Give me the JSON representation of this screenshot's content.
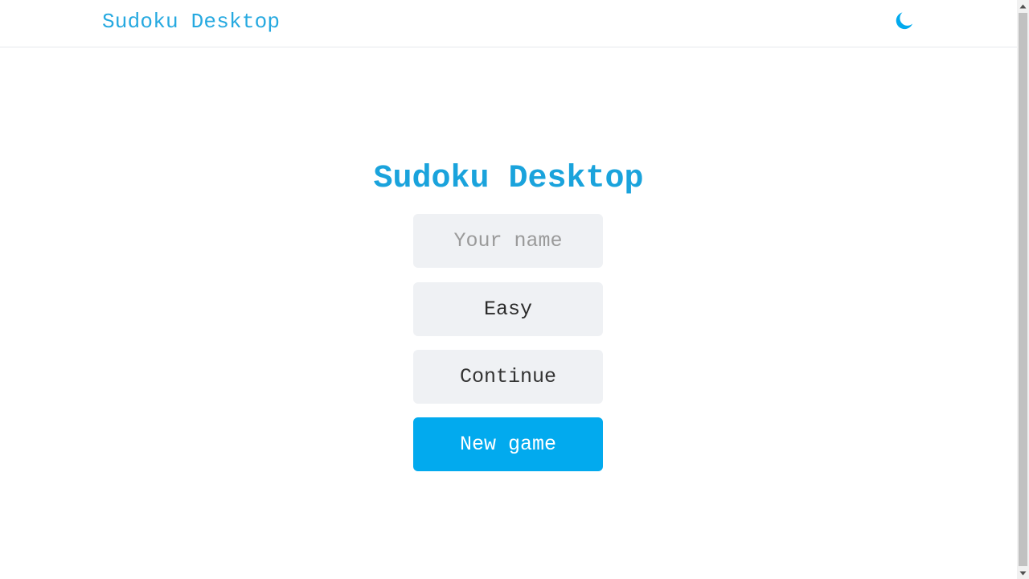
{
  "navbar": {
    "brand": "Sudoku Desktop",
    "theme_toggle_icon": "moon-icon"
  },
  "main": {
    "title": "Sudoku Desktop",
    "name_input": {
      "placeholder": "Your name",
      "value": ""
    },
    "difficulty": {
      "selected": "Easy"
    },
    "continue_label": "Continue",
    "new_game_label": "New game"
  },
  "colors": {
    "accent": "#02aaee",
    "title": "#1aa3dc",
    "brand": "#26a9e0",
    "control_bg": "#eff1f4"
  },
  "scrollbar": {
    "up_icon": "scroll-up-arrow-icon",
    "down_icon": "scroll-down-arrow-icon"
  }
}
